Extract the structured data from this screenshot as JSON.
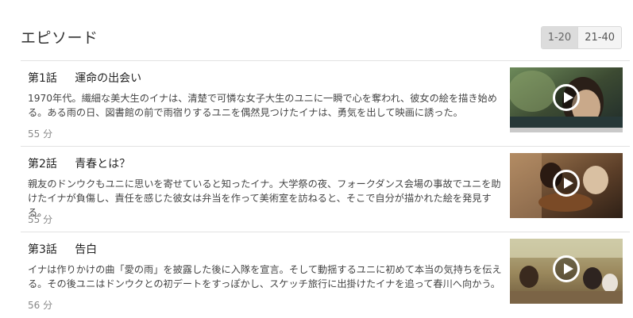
{
  "section": {
    "title": "エピソード",
    "pager": [
      {
        "label": "1-20",
        "active": true
      },
      {
        "label": "21-40",
        "active": false
      }
    ]
  },
  "episodes": [
    {
      "number": "第1話",
      "name": "運命の出会い",
      "description": "1970年代。繊細な美大生のイナは、清楚で可憐な女子大生のユニに一瞬で心を奪われ、彼女の絵を描き始める。ある雨の日、図書館の前で雨宿りするユニを偶然見つけたイナは、勇気を出して映画に誘った。",
      "duration": "55 分"
    },
    {
      "number": "第2話",
      "name": "青春とは？",
      "description": "親友のドンウクもユニに思いを寄せていると知ったイナ。大学祭の夜、フォークダンス会場の事故でユニを助けたイナが負傷し、責任を感じた彼女は弁当を作って美術室を訪ねると、そこで自分が描かれた絵を発見する。",
      "duration": "55 分"
    },
    {
      "number": "第3話",
      "name": "告白",
      "description": "イナは作りかけの曲「愛の雨」を披露した後に入隊を宣言。そして動揺するユニに初めて本当の気持ちを伝える。その後ユニはドンウクとの初デートをすっぽかし、スケッチ旅行に出掛けたイナを追って春川へ向かう。",
      "duration": "56 分"
    }
  ],
  "icons": {
    "play": "play-circle-icon"
  }
}
